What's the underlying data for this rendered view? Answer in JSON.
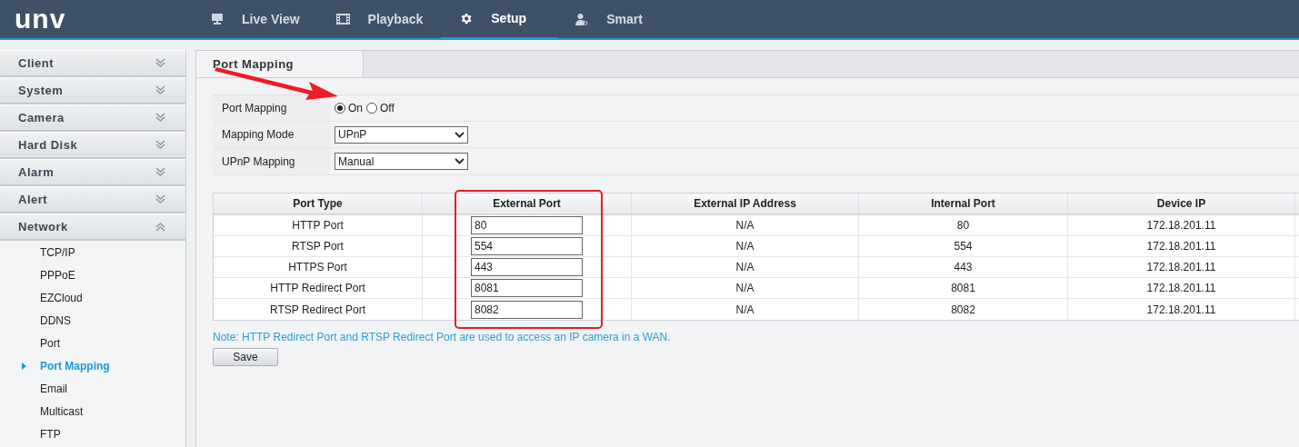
{
  "logo": "unv",
  "nav": [
    {
      "label": "Live View",
      "kind": "monitor",
      "selected": false
    },
    {
      "label": "Playback",
      "kind": "film",
      "selected": false
    },
    {
      "label": "Setup",
      "kind": "gear",
      "selected": true
    },
    {
      "label": "Smart",
      "kind": "person",
      "selected": false
    }
  ],
  "sidebar": [
    {
      "label": "Client",
      "expanded": false
    },
    {
      "label": "System",
      "expanded": false
    },
    {
      "label": "Camera",
      "expanded": false
    },
    {
      "label": "Hard Disk",
      "expanded": false
    },
    {
      "label": "Alarm",
      "expanded": false
    },
    {
      "label": "Alert",
      "expanded": false
    },
    {
      "label": "Network",
      "expanded": true,
      "children": [
        {
          "label": "TCP/IP",
          "selected": false
        },
        {
          "label": "PPPoE",
          "selected": false
        },
        {
          "label": "EZCloud",
          "selected": false
        },
        {
          "label": "DDNS",
          "selected": false
        },
        {
          "label": "Port",
          "selected": false
        },
        {
          "label": "Port Mapping",
          "selected": true
        },
        {
          "label": "Email",
          "selected": false
        },
        {
          "label": "Multicast",
          "selected": false
        },
        {
          "label": "FTP",
          "selected": false
        }
      ]
    }
  ],
  "tab": {
    "label": "Port Mapping"
  },
  "form": [
    {
      "kind": "radio",
      "label": "Port Mapping",
      "options": [
        {
          "label": "On",
          "selected": true
        },
        {
          "label": "Off",
          "selected": false
        }
      ]
    },
    {
      "kind": "select",
      "label": "Mapping Mode",
      "value": "UPnP"
    },
    {
      "kind": "select",
      "label": "UPnP Mapping",
      "value": "Manual"
    }
  ],
  "table": {
    "columns": [
      "Port Type",
      "External Port",
      "External IP Address",
      "Internal Port",
      "Device IP"
    ],
    "rows": [
      [
        "HTTP Port",
        "80",
        "N/A",
        "80",
        "172.18.201.11"
      ],
      [
        "RTSP Port",
        "554",
        "N/A",
        "554",
        "172.18.201.11"
      ],
      [
        "HTTPS Port",
        "443",
        "N/A",
        "443",
        "172.18.201.11"
      ],
      [
        "HTTP Redirect Port",
        "8081",
        "N/A",
        "8081",
        "172.18.201.11"
      ],
      [
        "RTSP Redirect Port",
        "8082",
        "N/A",
        "8082",
        "172.18.201.11"
      ]
    ]
  },
  "note": "Note: HTTP Redirect Port and RTSP Redirect Port are used to access an IP camera in a WAN.",
  "save_button": "Save"
}
